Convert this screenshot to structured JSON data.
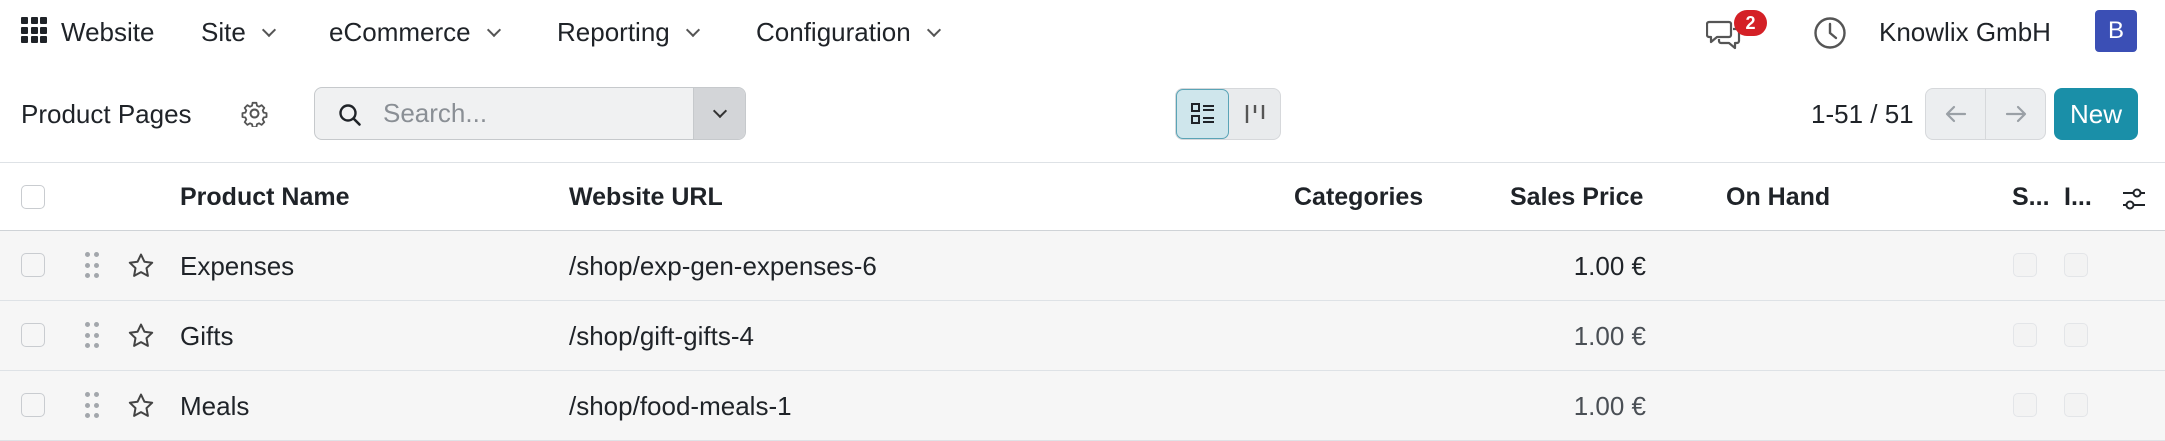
{
  "navbar": {
    "app_name": "Website",
    "menus": [
      "Site",
      "eCommerce",
      "Reporting",
      "Configuration"
    ],
    "messages_count": "2",
    "company": "Knowlix GmbH",
    "avatar_initial": "B",
    "accent_badge": "#d42026",
    "avatar_color": "#3b4fb5"
  },
  "control": {
    "title": "Product Pages",
    "search_placeholder": "Search...",
    "pager": "1-51 / 51",
    "new_label": "New",
    "accent": "#1a8fa8"
  },
  "table": {
    "columns": {
      "name": "Product Name",
      "url": "Website URL",
      "categories": "Categories",
      "price": "Sales Price",
      "on_hand": "On Hand",
      "s": "S...",
      "i": "I..."
    },
    "rows": [
      {
        "name": "Expenses",
        "url": "/shop/exp-gen-expenses-6",
        "price": "1.00 €"
      },
      {
        "name": "Gifts",
        "url": "/shop/gift-gifts-4",
        "price": "1.00 €"
      },
      {
        "name": "Meals",
        "url": "/shop/food-meals-1",
        "price": "1.00 €"
      }
    ]
  },
  "icons": [
    "apps-grid-icon",
    "chat-icon",
    "clock-icon",
    "gear-icon",
    "search-icon",
    "list-view-icon",
    "kanban-view-icon",
    "arrow-left-icon",
    "arrow-right-icon",
    "drag-handle-icon",
    "star-icon",
    "optional-columns-icon"
  ]
}
